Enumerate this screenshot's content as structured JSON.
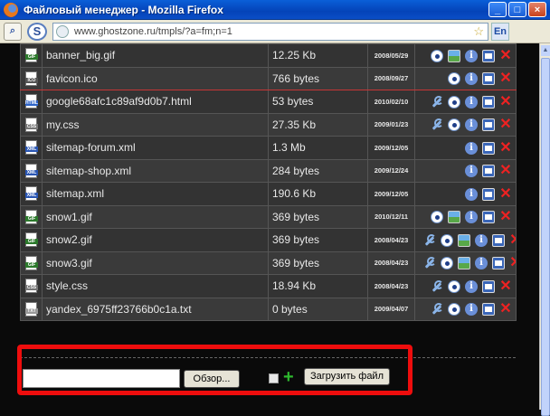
{
  "window": {
    "title": "Файловый менеджер - Mozilla Firefox",
    "min_icon": "_",
    "max_icon": "□",
    "close_icon": "×"
  },
  "browser": {
    "url": "www.ghostzone.ru/tmpls/?a=fm;n=1",
    "lang": "En"
  },
  "files": [
    {
      "name": "banner_big.gif",
      "size": "12.25 Kb",
      "date": "2008/05/29",
      "type": "gif",
      "actions": [
        "view",
        "img",
        "info",
        "win",
        "del"
      ]
    },
    {
      "name": "favicon.ico",
      "size": "766 bytes",
      "date": "2008/09/27",
      "type": "ico",
      "actions": [
        "view",
        "info",
        "win",
        "del"
      ]
    },
    {
      "name": "google68afc1c89af9d0b7.html",
      "size": "53 bytes",
      "date": "2010/02/10",
      "type": "html",
      "actions": [
        "edit",
        "view",
        "info",
        "win",
        "del"
      ]
    },
    {
      "name": "my.css",
      "size": "27.35 Kb",
      "date": "2009/01/23",
      "type": "css",
      "actions": [
        "edit",
        "view",
        "info",
        "win",
        "del"
      ]
    },
    {
      "name": "sitemap-forum.xml",
      "size": "1.3 Mb",
      "date": "2009/12/05",
      "type": "xml",
      "actions": [
        "info",
        "win",
        "del"
      ]
    },
    {
      "name": "sitemap-shop.xml",
      "size": "284 bytes",
      "date": "2009/12/24",
      "type": "xml",
      "actions": [
        "info",
        "win",
        "del"
      ]
    },
    {
      "name": "sitemap.xml",
      "size": "190.6 Kb",
      "date": "2009/12/05",
      "type": "xml",
      "actions": [
        "info",
        "win",
        "del"
      ]
    },
    {
      "name": "snow1.gif",
      "size": "369 bytes",
      "date": "2010/12/11",
      "type": "gif",
      "actions": [
        "view",
        "img",
        "info",
        "win",
        "del"
      ]
    },
    {
      "name": "snow2.gif",
      "size": "369 bytes",
      "date": "2008/04/23",
      "type": "gif",
      "actions": [
        "edit",
        "view",
        "img",
        "info",
        "win",
        "del"
      ]
    },
    {
      "name": "snow3.gif",
      "size": "369 bytes",
      "date": "2008/04/23",
      "type": "gif",
      "actions": [
        "edit",
        "view",
        "img",
        "info",
        "win",
        "del"
      ]
    },
    {
      "name": "style.css",
      "size": "18.94 Kb",
      "date": "2008/04/23",
      "type": "css",
      "actions": [
        "edit",
        "view",
        "info",
        "win",
        "del"
      ]
    },
    {
      "name": "yandex_6975ff23766b0c1a.txt",
      "size": "0 bytes",
      "date": "2009/04/07",
      "type": "txt",
      "actions": [
        "edit",
        "view",
        "info",
        "win",
        "del"
      ]
    }
  ],
  "upload": {
    "browse_label": "Обзор...",
    "upload_label": "Загрузить файл",
    "plus_icon": "+"
  }
}
